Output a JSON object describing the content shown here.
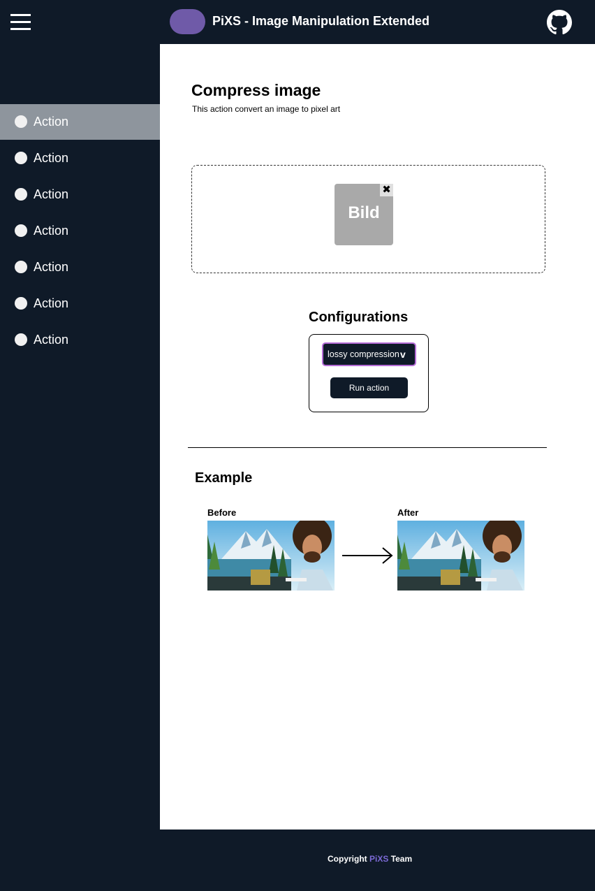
{
  "header": {
    "title": "PiXS - Image Manipulation Extended",
    "logo_color": "#6f5aa8"
  },
  "sidebar": {
    "items": [
      {
        "label": "Action",
        "active": true
      },
      {
        "label": "Action",
        "active": false
      },
      {
        "label": "Action",
        "active": false
      },
      {
        "label": "Action",
        "active": false
      },
      {
        "label": "Action",
        "active": false
      },
      {
        "label": "Action",
        "active": false
      },
      {
        "label": "Action",
        "active": false
      }
    ]
  },
  "main": {
    "title": "Compress image",
    "subtitle": "This action convert an image to pixel art",
    "upload": {
      "thumb_label": "Bild",
      "remove_glyph": "✖"
    },
    "config": {
      "title": "Configurations",
      "select_value": "lossy compression",
      "select_chevron": "v",
      "run_label": "Run action"
    },
    "example": {
      "title": "Example",
      "before_label": "Before",
      "after_label": "After"
    }
  },
  "footer": {
    "prefix": "Copyright ",
    "brand": "PiXS",
    "suffix": " Team",
    "brand_color": "#7c6ad6"
  },
  "colors": {
    "dark": "#0f1a28",
    "active_item": "#8e959d",
    "select_border": "#b46cd6"
  }
}
